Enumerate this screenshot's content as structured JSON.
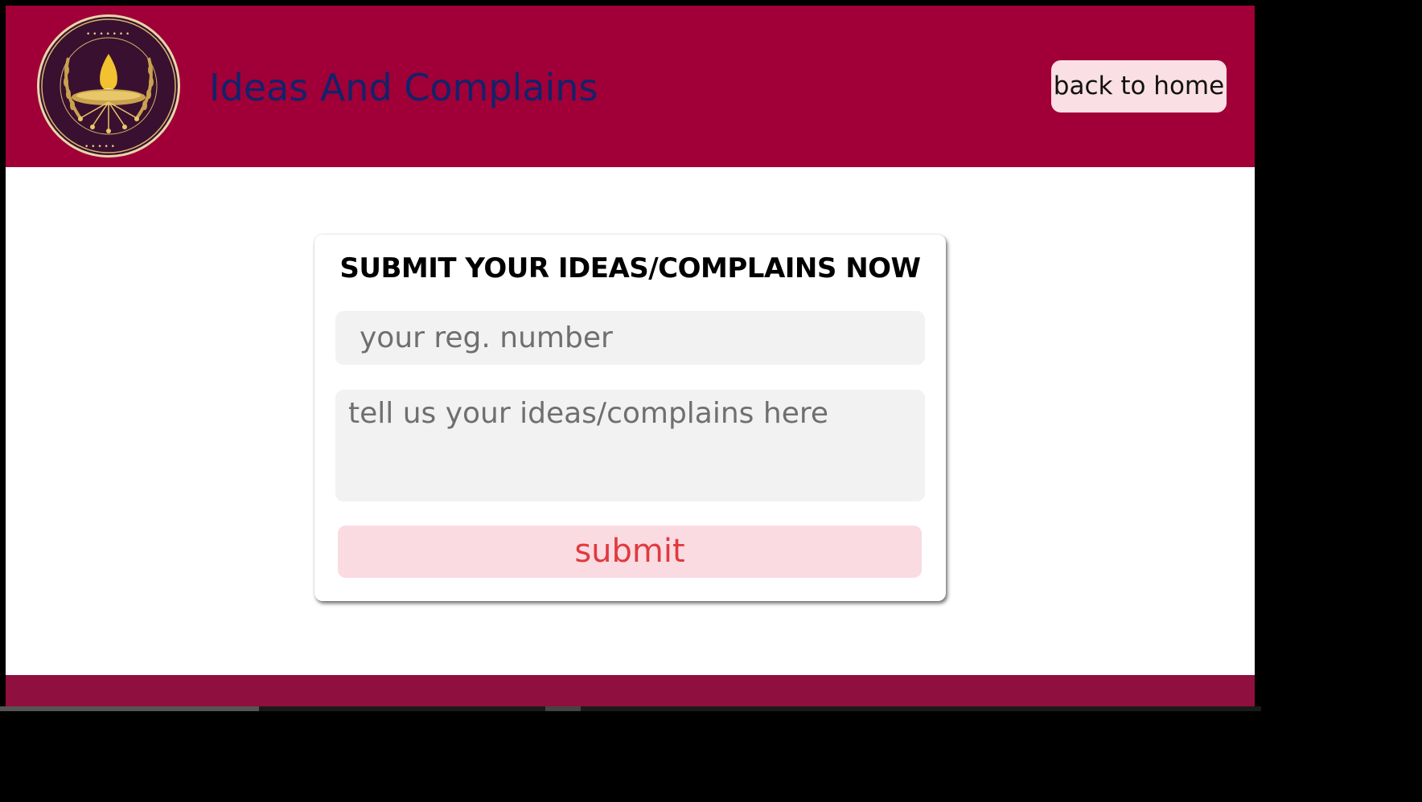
{
  "header": {
    "title": "Ideas And Complains",
    "back_button_label": "back to home",
    "logo_icon": "university-of-vavuniya-seal"
  },
  "form": {
    "heading": "SUBMIT YOUR IDEAS/COMPLAINS NOW",
    "reg_number_placeholder": "your reg. number",
    "reg_number_value": "",
    "message_placeholder": "tell us your ideas/complains here",
    "message_value": "",
    "submit_label": "submit"
  },
  "colors": {
    "header_bg": "#a00037",
    "footer_bg": "#8f0f3e",
    "title_text": "#13226b",
    "button_bg": "#fadbe1",
    "submit_text": "#e03a3e",
    "input_bg": "#f2f2f2"
  }
}
